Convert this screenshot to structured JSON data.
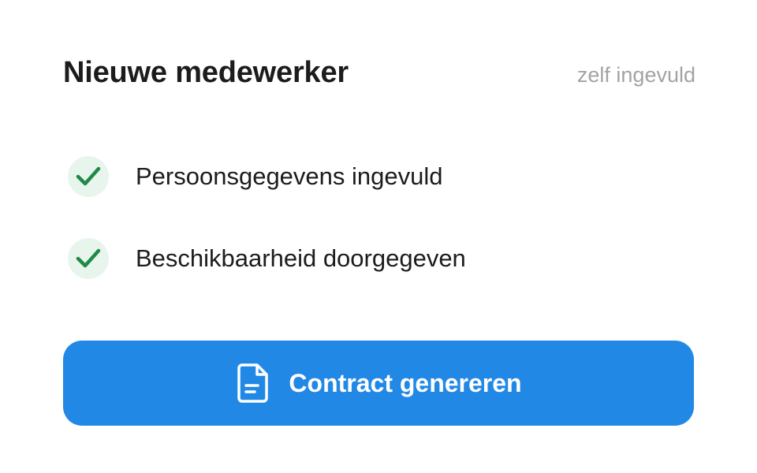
{
  "header": {
    "title": "Nieuwe medewerker",
    "status": "zelf ingevuld"
  },
  "checklist": {
    "items": [
      {
        "label": "Persoonsgegevens ingevuld",
        "icon": "check-icon",
        "done": true
      },
      {
        "label": "Beschikbaarheid doorgegeven",
        "icon": "check-icon",
        "done": true
      }
    ]
  },
  "action": {
    "label": "Contract genereren",
    "icon": "document-icon"
  },
  "colors": {
    "accent": "#2288e6",
    "success": "#1e8a46",
    "success_bg": "#e8f5ec",
    "muted_text": "#a3a3a3",
    "text": "#1c1c1e"
  }
}
